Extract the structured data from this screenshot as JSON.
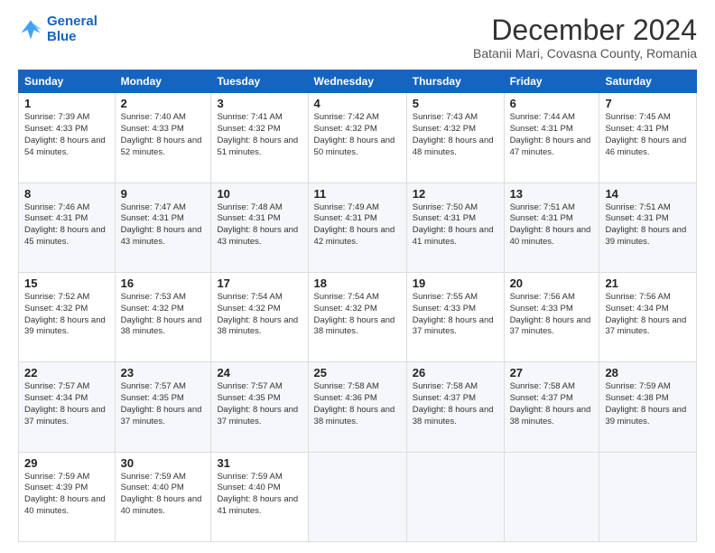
{
  "logo": {
    "line1": "General",
    "line2": "Blue"
  },
  "title": "December 2024",
  "subtitle": "Batanii Mari, Covasna County, Romania",
  "weekdays": [
    "Sunday",
    "Monday",
    "Tuesday",
    "Wednesday",
    "Thursday",
    "Friday",
    "Saturday"
  ],
  "weeks": [
    [
      {
        "day": "1",
        "sunrise": "7:39 AM",
        "sunset": "4:33 PM",
        "daylight": "8 hours and 54 minutes."
      },
      {
        "day": "2",
        "sunrise": "7:40 AM",
        "sunset": "4:33 PM",
        "daylight": "8 hours and 52 minutes."
      },
      {
        "day": "3",
        "sunrise": "7:41 AM",
        "sunset": "4:32 PM",
        "daylight": "8 hours and 51 minutes."
      },
      {
        "day": "4",
        "sunrise": "7:42 AM",
        "sunset": "4:32 PM",
        "daylight": "8 hours and 50 minutes."
      },
      {
        "day": "5",
        "sunrise": "7:43 AM",
        "sunset": "4:32 PM",
        "daylight": "8 hours and 48 minutes."
      },
      {
        "day": "6",
        "sunrise": "7:44 AM",
        "sunset": "4:31 PM",
        "daylight": "8 hours and 47 minutes."
      },
      {
        "day": "7",
        "sunrise": "7:45 AM",
        "sunset": "4:31 PM",
        "daylight": "8 hours and 46 minutes."
      }
    ],
    [
      {
        "day": "8",
        "sunrise": "7:46 AM",
        "sunset": "4:31 PM",
        "daylight": "8 hours and 45 minutes."
      },
      {
        "day": "9",
        "sunrise": "7:47 AM",
        "sunset": "4:31 PM",
        "daylight": "8 hours and 43 minutes."
      },
      {
        "day": "10",
        "sunrise": "7:48 AM",
        "sunset": "4:31 PM",
        "daylight": "8 hours and 43 minutes."
      },
      {
        "day": "11",
        "sunrise": "7:49 AM",
        "sunset": "4:31 PM",
        "daylight": "8 hours and 42 minutes."
      },
      {
        "day": "12",
        "sunrise": "7:50 AM",
        "sunset": "4:31 PM",
        "daylight": "8 hours and 41 minutes."
      },
      {
        "day": "13",
        "sunrise": "7:51 AM",
        "sunset": "4:31 PM",
        "daylight": "8 hours and 40 minutes."
      },
      {
        "day": "14",
        "sunrise": "7:51 AM",
        "sunset": "4:31 PM",
        "daylight": "8 hours and 39 minutes."
      }
    ],
    [
      {
        "day": "15",
        "sunrise": "7:52 AM",
        "sunset": "4:32 PM",
        "daylight": "8 hours and 39 minutes."
      },
      {
        "day": "16",
        "sunrise": "7:53 AM",
        "sunset": "4:32 PM",
        "daylight": "8 hours and 38 minutes."
      },
      {
        "day": "17",
        "sunrise": "7:54 AM",
        "sunset": "4:32 PM",
        "daylight": "8 hours and 38 minutes."
      },
      {
        "day": "18",
        "sunrise": "7:54 AM",
        "sunset": "4:32 PM",
        "daylight": "8 hours and 38 minutes."
      },
      {
        "day": "19",
        "sunrise": "7:55 AM",
        "sunset": "4:33 PM",
        "daylight": "8 hours and 37 minutes."
      },
      {
        "day": "20",
        "sunrise": "7:56 AM",
        "sunset": "4:33 PM",
        "daylight": "8 hours and 37 minutes."
      },
      {
        "day": "21",
        "sunrise": "7:56 AM",
        "sunset": "4:34 PM",
        "daylight": "8 hours and 37 minutes."
      }
    ],
    [
      {
        "day": "22",
        "sunrise": "7:57 AM",
        "sunset": "4:34 PM",
        "daylight": "8 hours and 37 minutes."
      },
      {
        "day": "23",
        "sunrise": "7:57 AM",
        "sunset": "4:35 PM",
        "daylight": "8 hours and 37 minutes."
      },
      {
        "day": "24",
        "sunrise": "7:57 AM",
        "sunset": "4:35 PM",
        "daylight": "8 hours and 37 minutes."
      },
      {
        "day": "25",
        "sunrise": "7:58 AM",
        "sunset": "4:36 PM",
        "daylight": "8 hours and 38 minutes."
      },
      {
        "day": "26",
        "sunrise": "7:58 AM",
        "sunset": "4:37 PM",
        "daylight": "8 hours and 38 minutes."
      },
      {
        "day": "27",
        "sunrise": "7:58 AM",
        "sunset": "4:37 PM",
        "daylight": "8 hours and 38 minutes."
      },
      {
        "day": "28",
        "sunrise": "7:59 AM",
        "sunset": "4:38 PM",
        "daylight": "8 hours and 39 minutes."
      }
    ],
    [
      {
        "day": "29",
        "sunrise": "7:59 AM",
        "sunset": "4:39 PM",
        "daylight": "8 hours and 40 minutes."
      },
      {
        "day": "30",
        "sunrise": "7:59 AM",
        "sunset": "4:40 PM",
        "daylight": "8 hours and 40 minutes."
      },
      {
        "day": "31",
        "sunrise": "7:59 AM",
        "sunset": "4:40 PM",
        "daylight": "8 hours and 41 minutes."
      },
      null,
      null,
      null,
      null
    ]
  ],
  "labels": {
    "sunrise": "Sunrise:",
    "sunset": "Sunset:",
    "daylight": "Daylight:"
  }
}
